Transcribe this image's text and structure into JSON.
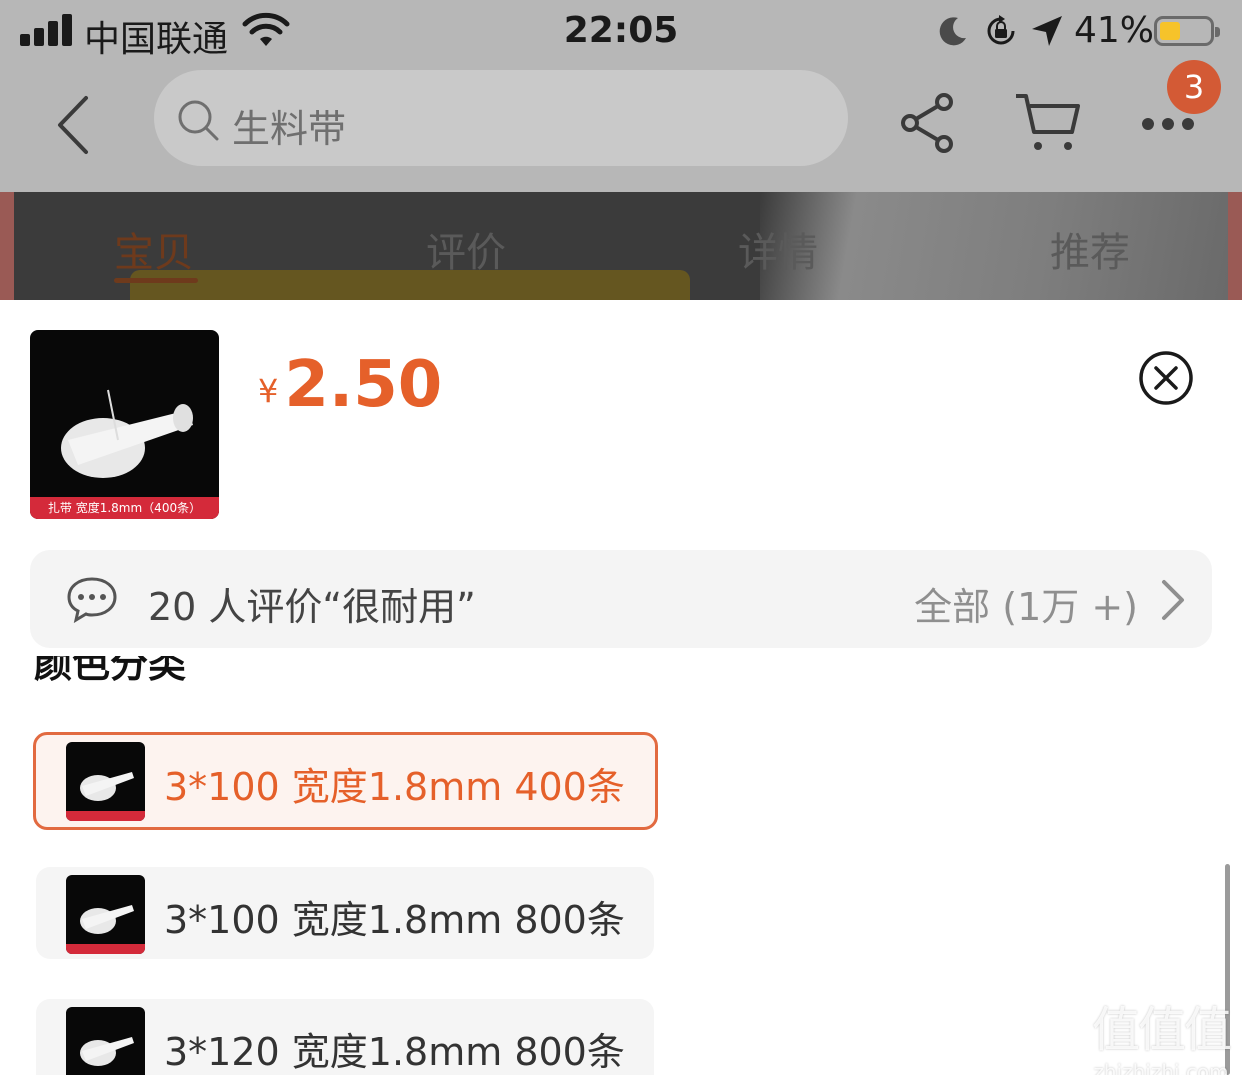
{
  "status_bar": {
    "carrier": "中国联通",
    "time": "22:05",
    "battery_percent": "41%",
    "battery_color": "#f6c32a"
  },
  "nav": {
    "search_placeholder": "生料带",
    "cart_badge_count": "3",
    "icons": [
      "back-icon",
      "search-icon",
      "share-icon",
      "cart-icon",
      "more-icon"
    ]
  },
  "tabs": [
    {
      "label": "宝贝",
      "active": true
    },
    {
      "label": "评价",
      "active": false
    },
    {
      "label": "详情",
      "active": false
    },
    {
      "label": "推荐",
      "active": false
    }
  ],
  "sheet": {
    "thumbnail_caption": "扎带 宽度1.8mm（400条）",
    "price_currency": "¥",
    "price_amount": "2.50",
    "accent_color": "#e5602a",
    "review_summary": "20 人评价“很耐用”",
    "review_all": "全部 (1万 +)",
    "section_title": "颜色分类",
    "sku_options": [
      {
        "label": "3*100 宽度1.8mm 400条",
        "selected": true
      },
      {
        "label": "3*100 宽度1.8mm 800条",
        "selected": false
      },
      {
        "label": "3*120 宽度1.8mm 800条",
        "selected": false
      }
    ]
  },
  "watermark": {
    "big": "值值值",
    "small": "zhizhizhi.com"
  }
}
